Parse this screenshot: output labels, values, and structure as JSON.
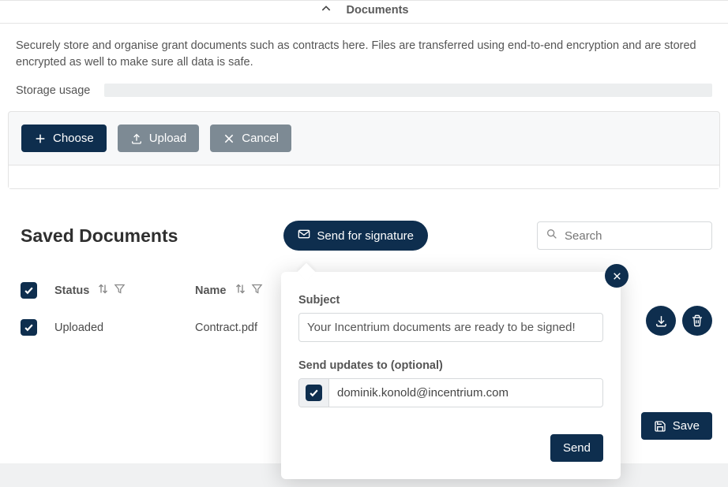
{
  "header": {
    "title": "Documents"
  },
  "intro": "Securely store and organise grant documents such as contracts here. Files are transferred using end-to-end encryption and are stored encrypted as well to make sure all data is safe.",
  "storage": {
    "label": "Storage usage"
  },
  "upload": {
    "choose_label": "Choose",
    "upload_label": "Upload",
    "cancel_label": "Cancel"
  },
  "saved": {
    "title": "Saved Documents",
    "signature_label": "Send for signature",
    "search_placeholder": "Search",
    "columns": {
      "status": "Status",
      "name": "Name"
    },
    "rows": [
      {
        "status": "Uploaded",
        "name": "Contract.pdf"
      }
    ]
  },
  "popover": {
    "subject_label": "Subject",
    "subject_value": "Your Incentrium documents are ready to be signed!",
    "updates_label": "Send updates to (optional)",
    "updates_value": "dominik.konold@incentrium.com",
    "send_label": "Send"
  },
  "footer": {
    "save_label": "Save"
  }
}
